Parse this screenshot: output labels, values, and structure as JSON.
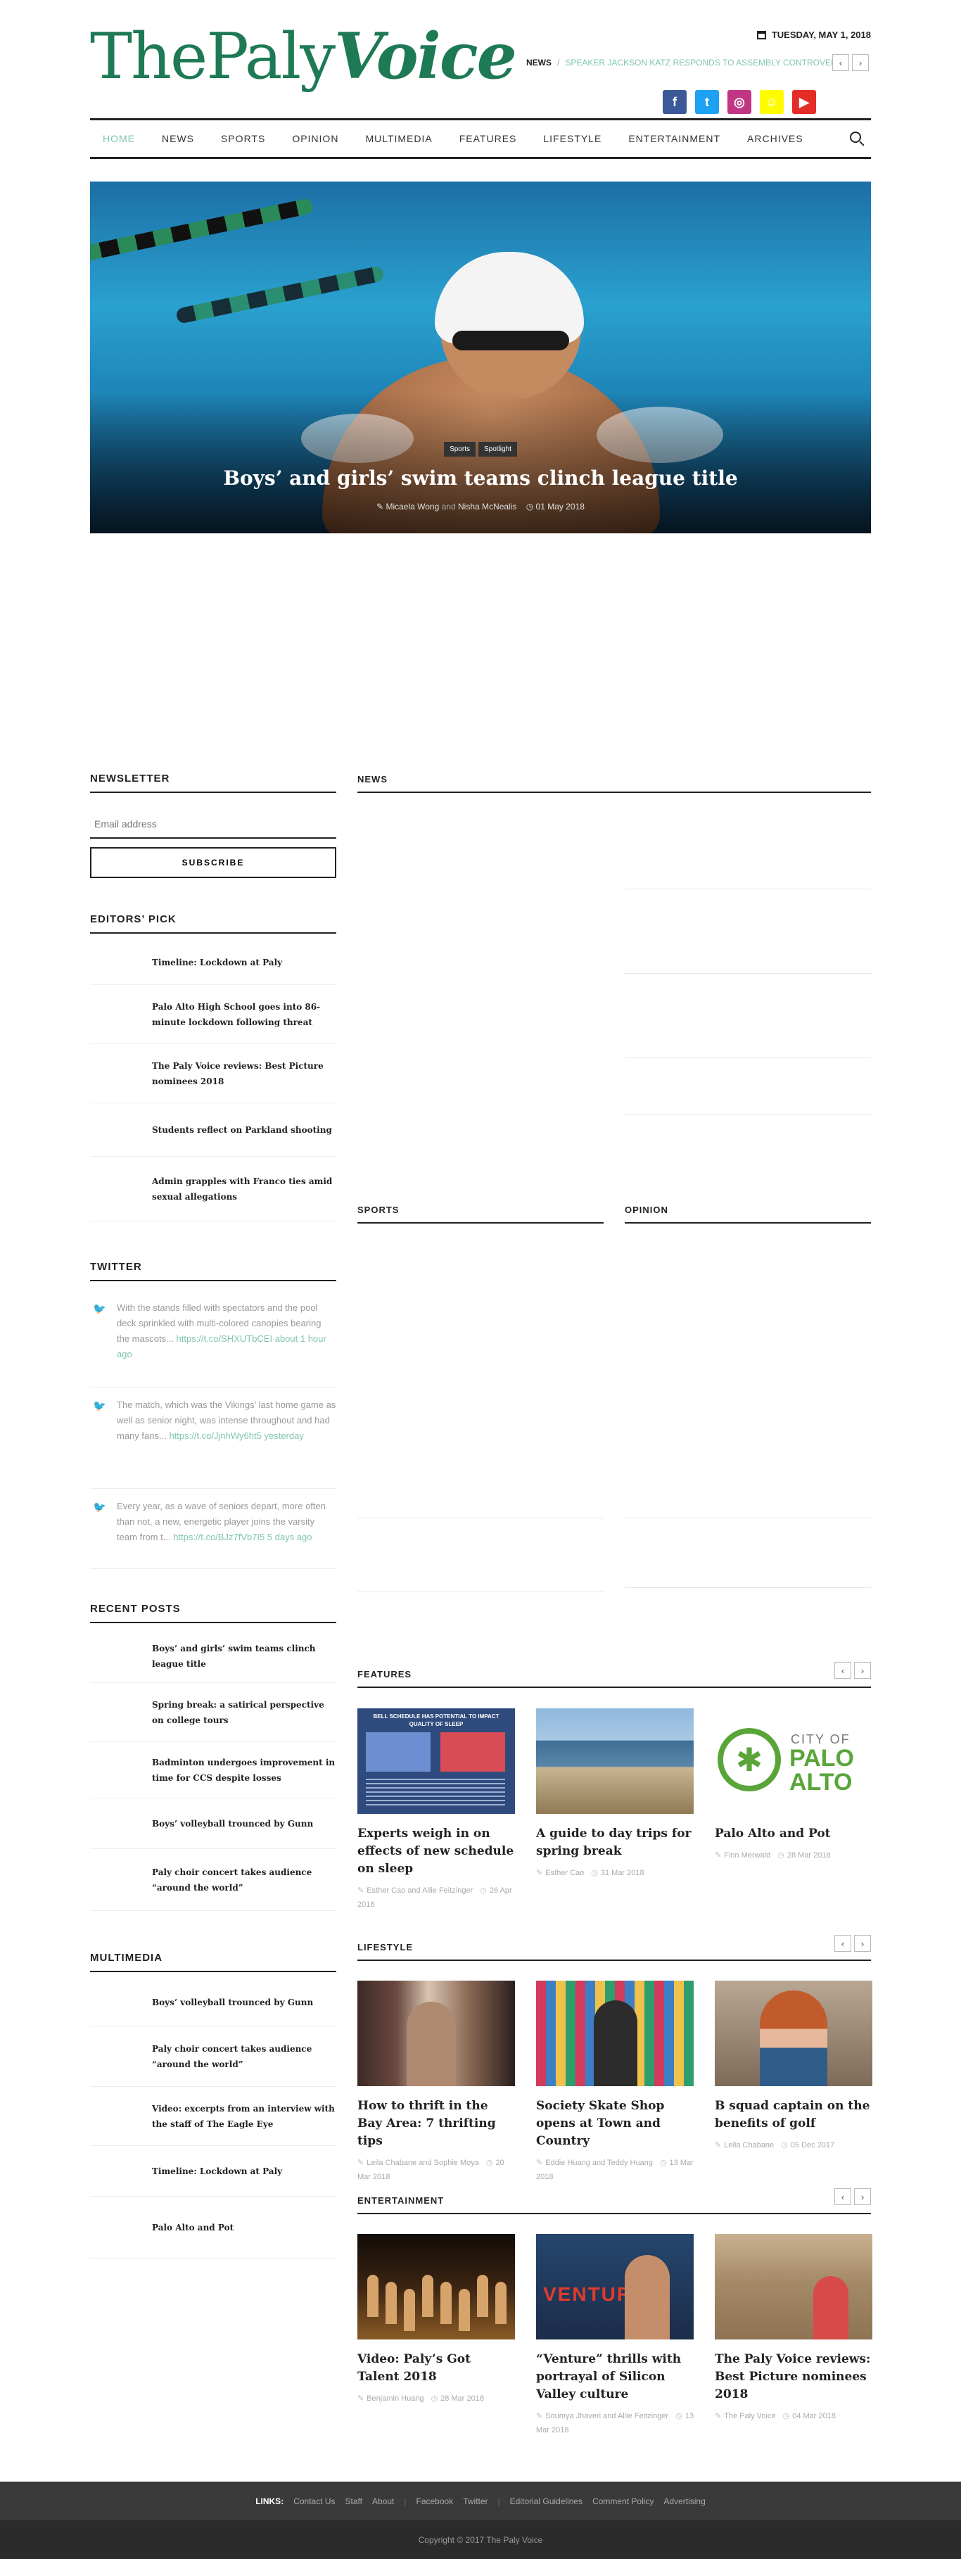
{
  "header": {
    "logo_part1": "ThePaly",
    "logo_part2": "Voice",
    "date": "TUESDAY, MAY 1, 2018",
    "ticker_label": "NEWS",
    "ticker_sep": "/",
    "ticker_text": "SPEAKER JACKSON KATZ RESPONDS TO ASSEMBLY CONTROVERSY",
    "prev": "‹",
    "next": "›",
    "social": [
      {
        "name": "facebook",
        "glyph": "f",
        "color": "#3b5998"
      },
      {
        "name": "twitter",
        "glyph": "t",
        "color": "#1da1f2"
      },
      {
        "name": "instagram",
        "glyph": "◎",
        "color": "#c13584"
      },
      {
        "name": "snapchat",
        "glyph": "☺",
        "color": "#fffc00"
      },
      {
        "name": "youtube",
        "glyph": "▶",
        "color": "#e52d27"
      }
    ]
  },
  "nav": [
    "HOME",
    "NEWS",
    "SPORTS",
    "OPINION",
    "MULTIMEDIA",
    "FEATURES",
    "LIFESTYLE",
    "ENTERTAINMENT",
    "ARCHIVES"
  ],
  "hero": {
    "tags": [
      "Sports",
      "Spotlight"
    ],
    "title": "Boys’ and girls’ swim teams clinch league title",
    "author1": "Micaela Wong",
    "and": "and",
    "author2": "Nisha McNealis",
    "date": "01 May 2018"
  },
  "sidebar": {
    "newsletter_title": "NEWSLETTER",
    "email_placeholder": "Email address",
    "subscribe": "SUBSCRIBE",
    "editors_title": "EDITORS’ PICK",
    "editors": [
      "Timeline: Lockdown at Paly",
      "Palo Alto High School goes into 86-minute lockdown following threat",
      "The Paly Voice reviews: Best Picture nominees 2018",
      "Students reflect on Parkland shooting",
      "Admin grapples with Franco ties amid sexual allegations"
    ],
    "twitter_title": "TWITTER",
    "tweets": [
      {
        "text": "With the stands filled with spectators and the pool deck sprinkled with multi-colored canopies bearing the mascots...",
        "link": "https://t.co/SHXUTbCEI",
        "time": "about 1 hour ago"
      },
      {
        "text": "The match, which was the Vikings’ last home game as well as senior night, was intense throughout and had many fans...",
        "link": "https://t.co/JjnhWy6ht5",
        "time": "yesterday"
      },
      {
        "text": "Every year, as a wave of seniors depart, more often than not, a new, energetic player joins the varsity team from t...",
        "link": "https://t.co/BJz7fVb7I5",
        "time": "5 days ago"
      }
    ],
    "recent_title": "RECENT POSTS",
    "recent": [
      "Boys’ and girls’ swim teams clinch league title",
      "Spring break: a satirical perspective on college tours",
      "Badminton undergoes improvement in time for CCS despite losses",
      "Boys’ volleyball trounced by Gunn",
      "Paly choir concert takes audience “around the world”"
    ],
    "multimedia_title": "MULTIMEDIA",
    "multimedia": [
      "Boys’ volleyball trounced by Gunn",
      "Paly choir concert takes audience “around the world”",
      "Video: excerpts from an interview with the staff of The Eagle Eye",
      "Timeline: Lockdown at Paly",
      "Palo Alto and Pot"
    ]
  },
  "sections": {
    "news": "NEWS",
    "sports": "SPORTS",
    "opinion": "OPINION",
    "features": "FEATURES",
    "lifestyle": "LIFESTYLE",
    "entertainment": "ENTERTAINMENT"
  },
  "features": [
    {
      "title": "Experts weigh in on effects of new schedule on sleep",
      "authors": "Esther Cao and Allie Feitzinger",
      "date": "26 Apr 2018",
      "img_title": "BELL SCHEDULE HAS POTENTIAL TO IMPACT QUALITY OF SLEEP"
    },
    {
      "title": "A guide to day trips for spring break",
      "authors": "Esther Cao",
      "date": "31 Mar 2018"
    },
    {
      "title": "Palo Alto and Pot",
      "authors": "Finn Merwald",
      "date": "28 Mar 2018",
      "img_text1": "CITY OF",
      "img_text2": "PALO",
      "img_text3": "ALTO"
    }
  ],
  "lifestyle": [
    {
      "title": "How to thrift in the Bay Area: 7 thrifting tips",
      "authors": "Leila Chabane and Sophie Moya",
      "date": "20 Mar 2018"
    },
    {
      "title": "Society Skate Shop opens at Town and Country",
      "authors": "Eddie Huang and Teddy Huang",
      "date": "13 Mar 2018"
    },
    {
      "title": "B squad captain on the benefits of golf",
      "authors": "Leila Chabane",
      "date": "05 Dec 2017"
    }
  ],
  "entertainment": [
    {
      "title": "Video: Paly’s Got Talent 2018",
      "authors": "Benjamin Huang",
      "date": "28 Mar 2018"
    },
    {
      "title": "“Venture” thrills with portrayal of Silicon Valley culture",
      "authors": "Soumya Jhaveri and Allie Feitzinger",
      "date": "13 Mar 2018",
      "img_text": "VENTURE"
    },
    {
      "title": "The Paly Voice reviews: Best Picture nominees 2018",
      "authors": "The Paly Voice",
      "date": "04 Mar 2018"
    }
  ],
  "footer": {
    "links_label": "LINKS:",
    "links": [
      "Contact Us",
      "Staff",
      "About",
      "Facebook",
      "Twitter",
      "Editorial Guidelines",
      "Comment Policy",
      "Advertising"
    ],
    "copyright": "Copyright © 2017 The Paly Voice"
  }
}
